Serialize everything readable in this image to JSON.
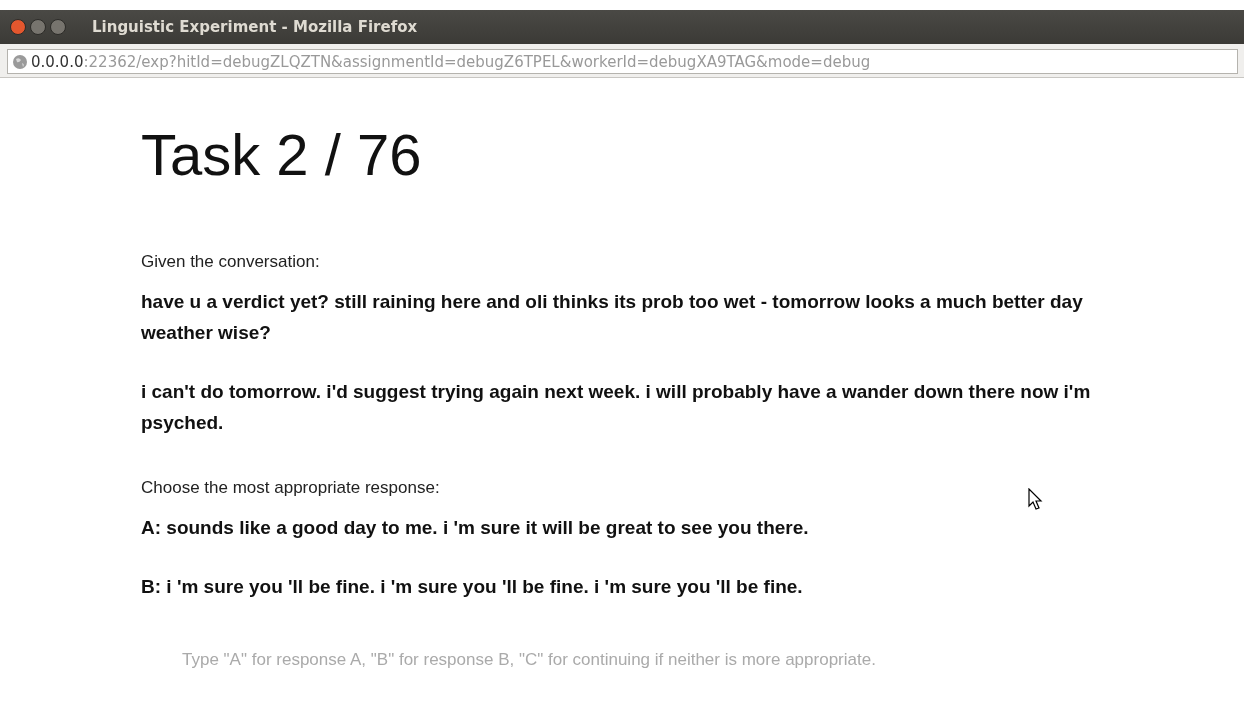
{
  "window": {
    "title": "Linguistic Experiment - Mozilla Firefox"
  },
  "address_bar": {
    "host": "0.0.0.0",
    "path": ":22362/exp?hitId=debugZLQZTN&assignmentId=debugZ6TPEL&workerId=debugXA9TAG&mode=debug"
  },
  "heading": "Task 2 / 76",
  "conversation_label": "Given the conversation:",
  "conversation": [
    "have u a verdict yet? still raining here and oli thinks its prob too wet - tomorrow looks a much better day weather wise?",
    "i can't do tomorrow. i'd suggest trying again next week. i will probably have a wander down there now i'm psyched."
  ],
  "responses_label": "Choose the most appropriate response:",
  "responses": [
    "A: sounds like a good day to me. i 'm sure it will be great to see you there.",
    "B: i 'm sure you 'll be fine. i 'm sure you 'll be fine. i 'm sure you 'll be fine."
  ],
  "instructions": "Type \"A\" for response A, \"B\" for response B, \"C\" for continuing if neither is more appropriate."
}
